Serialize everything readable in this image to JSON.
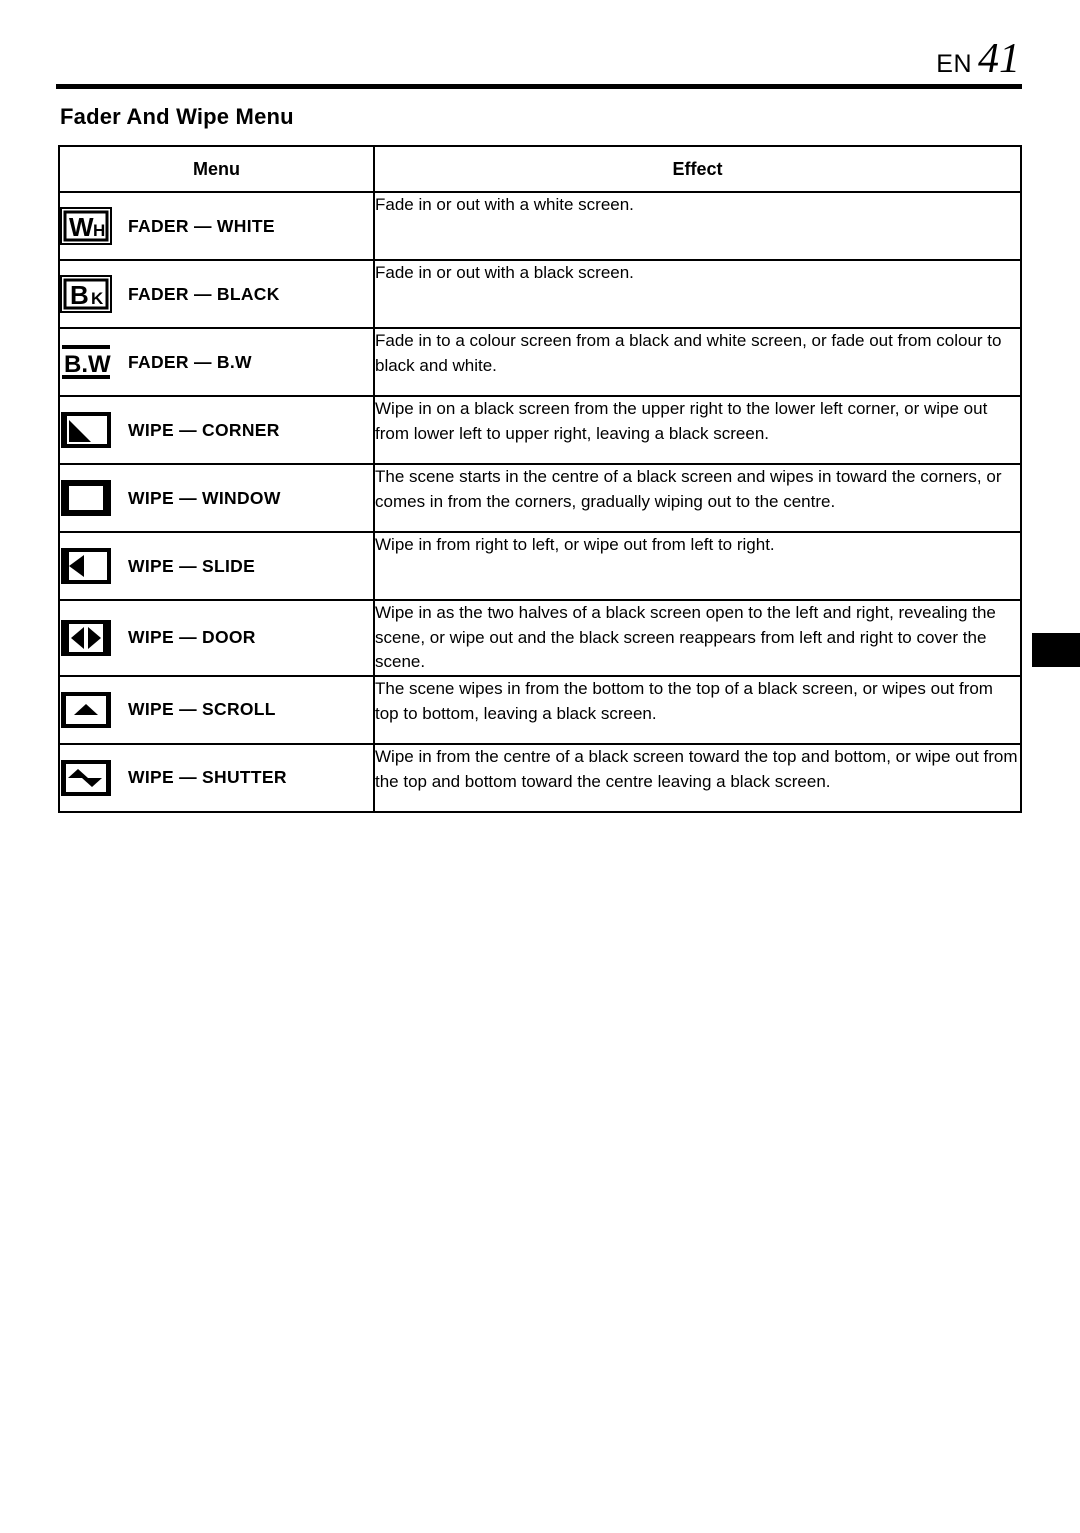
{
  "header": {
    "lang": "EN",
    "page_number": "41"
  },
  "section": {
    "title": "Fader And Wipe Menu"
  },
  "table": {
    "columns": [
      "Menu",
      "Effect"
    ],
    "rows": [
      {
        "icon": "fader-white-icon",
        "icon_text": {
          "big": "W",
          "small": "H"
        },
        "menu": "FADER — WHITE",
        "effect": "Fade in or out with a white screen."
      },
      {
        "icon": "fader-black-icon",
        "icon_text": {
          "big": "B",
          "small": "K"
        },
        "menu": "FADER — BLACK",
        "effect": "Fade in or out with a black screen."
      },
      {
        "icon": "fader-bw-icon",
        "icon_text": {
          "big": "B.W",
          "small": ""
        },
        "menu": "FADER — B.W",
        "effect": "Fade in to a colour screen from a black and white screen, or fade out from colour to black and white."
      },
      {
        "icon": "wipe-corner-icon",
        "menu": "WIPE — CORNER",
        "effect": "Wipe in on a black screen from the upper right to the lower left corner, or wipe out from lower left to upper right, leaving a black screen."
      },
      {
        "icon": "wipe-window-icon",
        "menu": "WIPE — WINDOW",
        "effect": "The scene starts in the centre of a black screen and wipes in toward the corners, or comes in from the corners, gradually wiping out to the centre."
      },
      {
        "icon": "wipe-slide-icon",
        "menu": "WIPE — SLIDE",
        "effect": "Wipe in from right to left, or wipe out from left to right."
      },
      {
        "icon": "wipe-door-icon",
        "menu": "WIPE — DOOR",
        "effect": "Wipe in as the two halves of a black screen open to the left and right, revealing the scene, or wipe out and the black screen reappears from left and right to cover the scene."
      },
      {
        "icon": "wipe-scroll-icon",
        "menu": "WIPE — SCROLL",
        "effect": "The scene wipes in from the bottom to the top of a black screen, or wipes out from top to bottom, leaving a black screen."
      },
      {
        "icon": "wipe-shutter-icon",
        "menu": "WIPE — SHUTTER",
        "effect": "Wipe in from the centre of a black screen toward the top and bottom, or wipe out from the top and bottom toward the centre leaving a black screen."
      }
    ]
  },
  "colors": {
    "ink": "#000000",
    "paper": "#ffffff"
  }
}
